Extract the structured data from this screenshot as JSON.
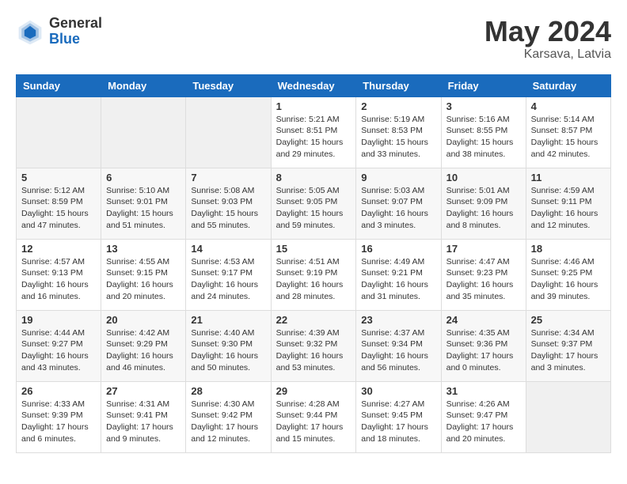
{
  "header": {
    "logo_general": "General",
    "logo_blue": "Blue",
    "month_year": "May 2024",
    "location": "Karsava, Latvia"
  },
  "weekdays": [
    "Sunday",
    "Monday",
    "Tuesday",
    "Wednesday",
    "Thursday",
    "Friday",
    "Saturday"
  ],
  "weeks": [
    [
      {
        "day": "",
        "info": ""
      },
      {
        "day": "",
        "info": ""
      },
      {
        "day": "",
        "info": ""
      },
      {
        "day": "1",
        "info": "Sunrise: 5:21 AM\nSunset: 8:51 PM\nDaylight: 15 hours\nand 29 minutes."
      },
      {
        "day": "2",
        "info": "Sunrise: 5:19 AM\nSunset: 8:53 PM\nDaylight: 15 hours\nand 33 minutes."
      },
      {
        "day": "3",
        "info": "Sunrise: 5:16 AM\nSunset: 8:55 PM\nDaylight: 15 hours\nand 38 minutes."
      },
      {
        "day": "4",
        "info": "Sunrise: 5:14 AM\nSunset: 8:57 PM\nDaylight: 15 hours\nand 42 minutes."
      }
    ],
    [
      {
        "day": "5",
        "info": "Sunrise: 5:12 AM\nSunset: 8:59 PM\nDaylight: 15 hours\nand 47 minutes."
      },
      {
        "day": "6",
        "info": "Sunrise: 5:10 AM\nSunset: 9:01 PM\nDaylight: 15 hours\nand 51 minutes."
      },
      {
        "day": "7",
        "info": "Sunrise: 5:08 AM\nSunset: 9:03 PM\nDaylight: 15 hours\nand 55 minutes."
      },
      {
        "day": "8",
        "info": "Sunrise: 5:05 AM\nSunset: 9:05 PM\nDaylight: 15 hours\nand 59 minutes."
      },
      {
        "day": "9",
        "info": "Sunrise: 5:03 AM\nSunset: 9:07 PM\nDaylight: 16 hours\nand 3 minutes."
      },
      {
        "day": "10",
        "info": "Sunrise: 5:01 AM\nSunset: 9:09 PM\nDaylight: 16 hours\nand 8 minutes."
      },
      {
        "day": "11",
        "info": "Sunrise: 4:59 AM\nSunset: 9:11 PM\nDaylight: 16 hours\nand 12 minutes."
      }
    ],
    [
      {
        "day": "12",
        "info": "Sunrise: 4:57 AM\nSunset: 9:13 PM\nDaylight: 16 hours\nand 16 minutes."
      },
      {
        "day": "13",
        "info": "Sunrise: 4:55 AM\nSunset: 9:15 PM\nDaylight: 16 hours\nand 20 minutes."
      },
      {
        "day": "14",
        "info": "Sunrise: 4:53 AM\nSunset: 9:17 PM\nDaylight: 16 hours\nand 24 minutes."
      },
      {
        "day": "15",
        "info": "Sunrise: 4:51 AM\nSunset: 9:19 PM\nDaylight: 16 hours\nand 28 minutes."
      },
      {
        "day": "16",
        "info": "Sunrise: 4:49 AM\nSunset: 9:21 PM\nDaylight: 16 hours\nand 31 minutes."
      },
      {
        "day": "17",
        "info": "Sunrise: 4:47 AM\nSunset: 9:23 PM\nDaylight: 16 hours\nand 35 minutes."
      },
      {
        "day": "18",
        "info": "Sunrise: 4:46 AM\nSunset: 9:25 PM\nDaylight: 16 hours\nand 39 minutes."
      }
    ],
    [
      {
        "day": "19",
        "info": "Sunrise: 4:44 AM\nSunset: 9:27 PM\nDaylight: 16 hours\nand 43 minutes."
      },
      {
        "day": "20",
        "info": "Sunrise: 4:42 AM\nSunset: 9:29 PM\nDaylight: 16 hours\nand 46 minutes."
      },
      {
        "day": "21",
        "info": "Sunrise: 4:40 AM\nSunset: 9:30 PM\nDaylight: 16 hours\nand 50 minutes."
      },
      {
        "day": "22",
        "info": "Sunrise: 4:39 AM\nSunset: 9:32 PM\nDaylight: 16 hours\nand 53 minutes."
      },
      {
        "day": "23",
        "info": "Sunrise: 4:37 AM\nSunset: 9:34 PM\nDaylight: 16 hours\nand 56 minutes."
      },
      {
        "day": "24",
        "info": "Sunrise: 4:35 AM\nSunset: 9:36 PM\nDaylight: 17 hours\nand 0 minutes."
      },
      {
        "day": "25",
        "info": "Sunrise: 4:34 AM\nSunset: 9:37 PM\nDaylight: 17 hours\nand 3 minutes."
      }
    ],
    [
      {
        "day": "26",
        "info": "Sunrise: 4:33 AM\nSunset: 9:39 PM\nDaylight: 17 hours\nand 6 minutes."
      },
      {
        "day": "27",
        "info": "Sunrise: 4:31 AM\nSunset: 9:41 PM\nDaylight: 17 hours\nand 9 minutes."
      },
      {
        "day": "28",
        "info": "Sunrise: 4:30 AM\nSunset: 9:42 PM\nDaylight: 17 hours\nand 12 minutes."
      },
      {
        "day": "29",
        "info": "Sunrise: 4:28 AM\nSunset: 9:44 PM\nDaylight: 17 hours\nand 15 minutes."
      },
      {
        "day": "30",
        "info": "Sunrise: 4:27 AM\nSunset: 9:45 PM\nDaylight: 17 hours\nand 18 minutes."
      },
      {
        "day": "31",
        "info": "Sunrise: 4:26 AM\nSunset: 9:47 PM\nDaylight: 17 hours\nand 20 minutes."
      },
      {
        "day": "",
        "info": ""
      }
    ]
  ]
}
